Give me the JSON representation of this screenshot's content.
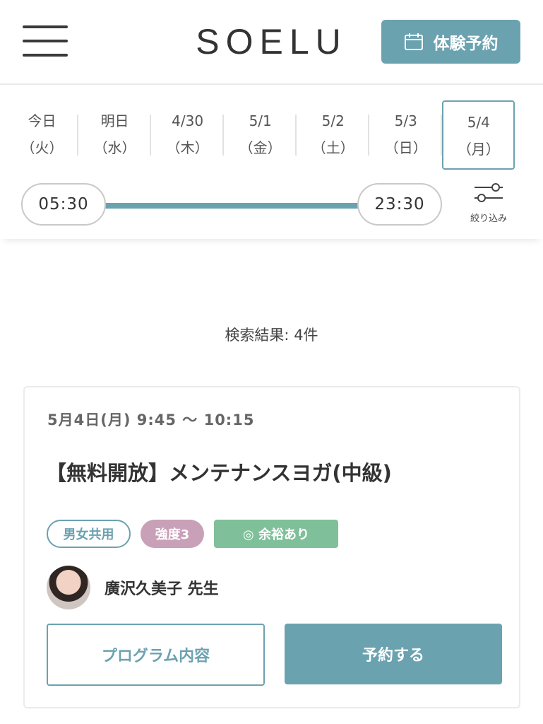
{
  "header": {
    "logo": "SOELU",
    "trial_button": "体験予約",
    "trial_icon": "calendar-icon",
    "menu_icon": "hamburger-menu-icon"
  },
  "filter": {
    "dates": [
      {
        "date": "今日",
        "day": "（火）"
      },
      {
        "date": "明日",
        "day": "（水）"
      },
      {
        "date": "4/30",
        "day": "（木）"
      },
      {
        "date": "5/1",
        "day": "（金）"
      },
      {
        "date": "5/2",
        "day": "（土）"
      },
      {
        "date": "5/3",
        "day": "（日）"
      },
      {
        "date": "5/4",
        "day": "（月）"
      }
    ],
    "selected_date": "5/4",
    "time_start": "05:30",
    "time_end": "23:30",
    "narrow_label": "絞り込み",
    "narrow_icon": "sliders-icon"
  },
  "results": {
    "count_text": "検索結果: 4件"
  },
  "card": {
    "datetime": "5月4日(月) 9:45 〜 10:15",
    "title": "【無料開放】メンテナンスヨガ(中級)",
    "tags": {
      "gender": "男女共用",
      "intensity": "強度3",
      "availability": "◎  余裕あり"
    },
    "instructor": "廣沢久美子 先生",
    "program_button": "プログラム内容",
    "reserve_button": "予約する"
  },
  "colors": {
    "accent": "#6ba2b0",
    "intensity": "#c8a0b8",
    "availability": "#7fc09a"
  }
}
